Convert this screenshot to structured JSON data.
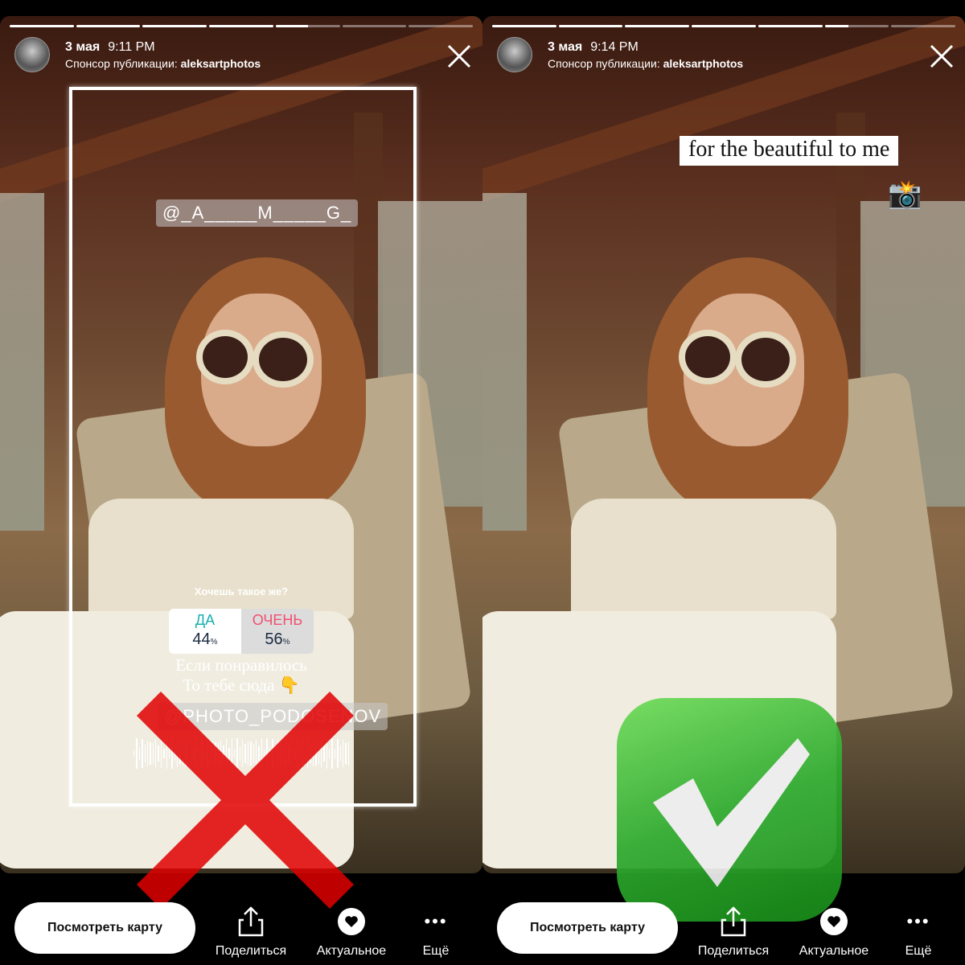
{
  "left": {
    "date": "3 мая",
    "time": "9:11 PM",
    "sponsor_label": "Спонсор публикации:",
    "sponsor_name": "aleksartphotos",
    "progress": {
      "segments": 7,
      "current": 5,
      "current_fill": 0.5
    },
    "mention_top": "@_A_____M_____G_",
    "poll": {
      "question": "Хочешь такое же?",
      "options": [
        {
          "label": "ДА",
          "percent": "44",
          "color": "#1ab0b0"
        },
        {
          "label": "ОЧЕНЬ",
          "percent": "56",
          "color": "#f0506e"
        }
      ]
    },
    "text_line1": "Если понравилось",
    "text_line2": "То тебе сюда 👇",
    "mention_bottom": "@PHOTO_PODOSENOV",
    "overlay": "red-cross-icon"
  },
  "right": {
    "date": "3 мая",
    "time": "9:14 PM",
    "sponsor_label": "Спонсор публикации:",
    "sponsor_name": "aleksartphotos",
    "progress": {
      "segments": 7,
      "current": 6,
      "current_fill": 0.37
    },
    "caption": "for the beautiful to me",
    "emoji": "📸",
    "overlay": "green-checkmark-icon"
  },
  "bottom": {
    "view_map": "Посмотреть карту",
    "share": "Поделиться",
    "highlight": "Актуальное",
    "more": "Ещё"
  },
  "colors": {
    "cross": "#e00000",
    "check": "#2eaa2e"
  }
}
